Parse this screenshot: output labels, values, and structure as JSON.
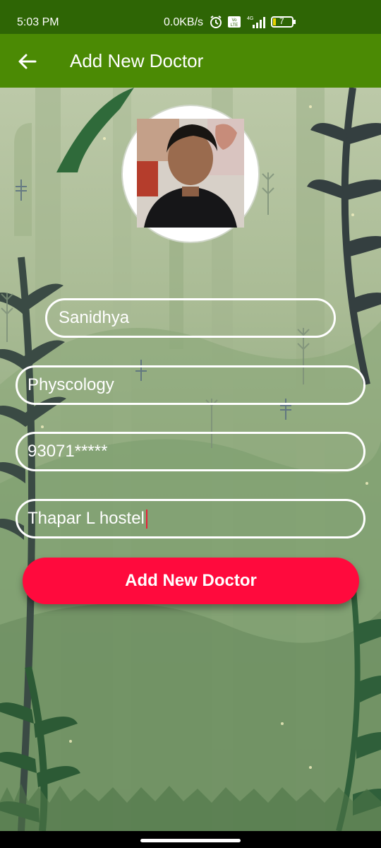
{
  "status_bar": {
    "time": "5:03 PM",
    "network_speed": "0.0KB/s",
    "network_type": "4G",
    "volte_label": "Vo LTE",
    "battery_level": "7",
    "icons": [
      "alarm-icon",
      "volte-icon",
      "signal-icon",
      "battery-icon"
    ]
  },
  "app_bar": {
    "title": "Add New Doctor",
    "back_icon": "arrow-left-icon"
  },
  "form": {
    "profile_image": "doctor-photo",
    "name_value": "Sanidhya",
    "specialization_value": "Physcology",
    "phone_value": "93071*****",
    "address_value": "Thapar L hostel",
    "submit_label": "Add New Doctor"
  },
  "colors": {
    "status_bar_bg": "#2e6505",
    "app_bar_bg": "#4b8a04",
    "button_bg": "#ff0a3d",
    "field_border": "#ffffff",
    "cursor": "#e8203a"
  }
}
